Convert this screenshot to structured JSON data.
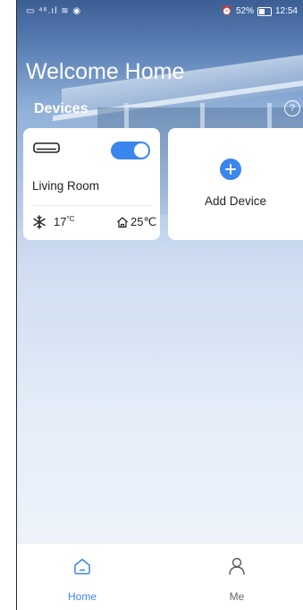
{
  "status_bar": {
    "left_icons": "▭ ⁴⁶.ıl ≋ ◉",
    "alarm_icon": "alarm-icon",
    "battery_percent": "52%",
    "time": "12:54"
  },
  "header": {
    "title": "Welcome Home",
    "section_label": "Devices",
    "help_glyph": "?"
  },
  "devices": [
    {
      "name": "Living Room",
      "power_on": true,
      "set_temp": "17",
      "set_temp_unit": "°C",
      "room_temp": "25℃",
      "icon": "air-conditioner-icon"
    }
  ],
  "add_device": {
    "label": "Add Device",
    "icon": "plus-circle-icon"
  },
  "tabs": [
    {
      "label": "Home",
      "icon": "home-icon",
      "active": true
    },
    {
      "label": "Me",
      "icon": "user-icon",
      "active": false
    }
  ],
  "colors": {
    "accent": "#3b86ee",
    "inactive_tab": "#666666",
    "text": "#222222"
  }
}
